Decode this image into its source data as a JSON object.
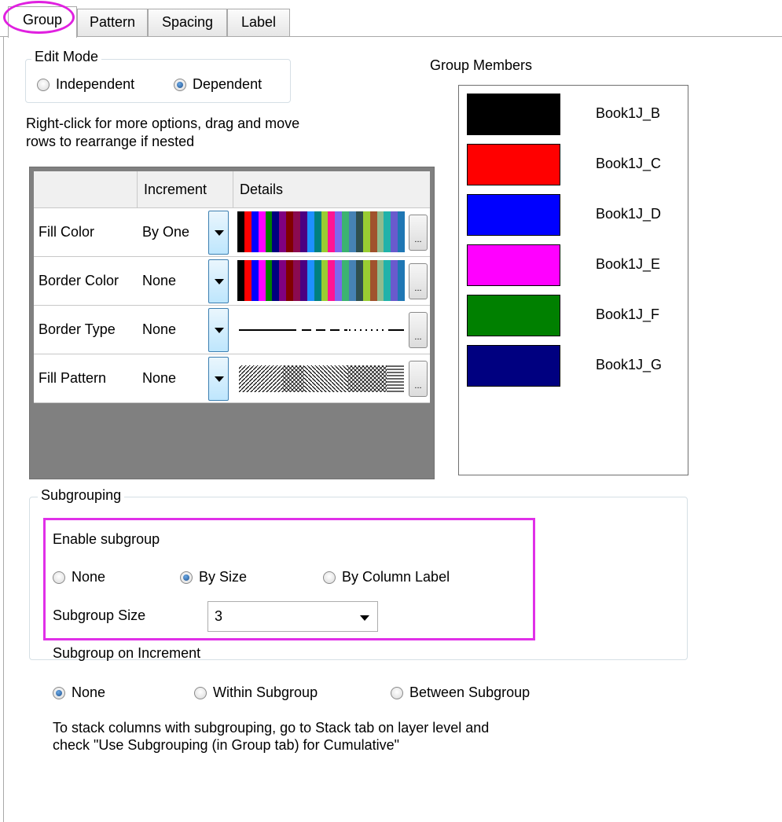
{
  "tabs": [
    "Group",
    "Pattern",
    "Spacing",
    "Label"
  ],
  "edit_mode": {
    "legend": "Edit Mode",
    "independent": "Independent",
    "dependent": "Dependent",
    "selected": "Dependent"
  },
  "hint_line1": "Right-click for more options, drag and move",
  "hint_line2": "rows to  rearrange if nested",
  "grid": {
    "headers": [
      "",
      "Increment",
      "Details"
    ],
    "rows": [
      {
        "name": "Fill Color",
        "increment": "By One"
      },
      {
        "name": "Border Color",
        "increment": "None"
      },
      {
        "name": "Border Type",
        "increment": "None"
      },
      {
        "name": "Fill Pattern",
        "increment": "None"
      }
    ],
    "color_list": [
      "#000000",
      "#ff0000",
      "#0000ff",
      "#ff00ff",
      "#008000",
      "#000080",
      "#800080",
      "#800000",
      "#8b0a50",
      "#4b0082",
      "#1e90ff",
      "#008080",
      "#9acd32",
      "#ff1493",
      "#7b68ee",
      "#3cb371",
      "#4682b4",
      "#2f4f4f",
      "#9acd32",
      "#a0522d",
      "#8fbc8f",
      "#20b2aa",
      "#6a5acd",
      "#1f77b4"
    ],
    "ellipsis": "..."
  },
  "group_members": {
    "title": "Group Members",
    "items": [
      {
        "label": "Book1J_B",
        "color": "#000000"
      },
      {
        "label": "Book1J_C",
        "color": "#ff0000"
      },
      {
        "label": "Book1J_D",
        "color": "#0000ff"
      },
      {
        "label": "Book1J_E",
        "color": "#ff00ff"
      },
      {
        "label": "Book1J_F",
        "color": "#008000"
      },
      {
        "label": "Book1J_G",
        "color": "#000080"
      }
    ]
  },
  "subgrouping": {
    "legend": "Subgrouping",
    "enable_label": "Enable subgroup",
    "opt_none": "None",
    "opt_by_size": "By Size",
    "opt_by_column_label": "By Column Label",
    "selected": "By Size",
    "size_label": "Subgroup Size",
    "size_value": "3",
    "on_increment_label": "Subgroup on Increment",
    "inc_none": "None",
    "inc_within": "Within Subgroup",
    "inc_between": "Between Subgroup",
    "inc_selected": "None",
    "note_line1": "To stack columns with subgrouping, go to Stack tab on layer level and",
    "note_line2": "check \"Use Subgrouping (in Group tab) for Cumulative\""
  }
}
